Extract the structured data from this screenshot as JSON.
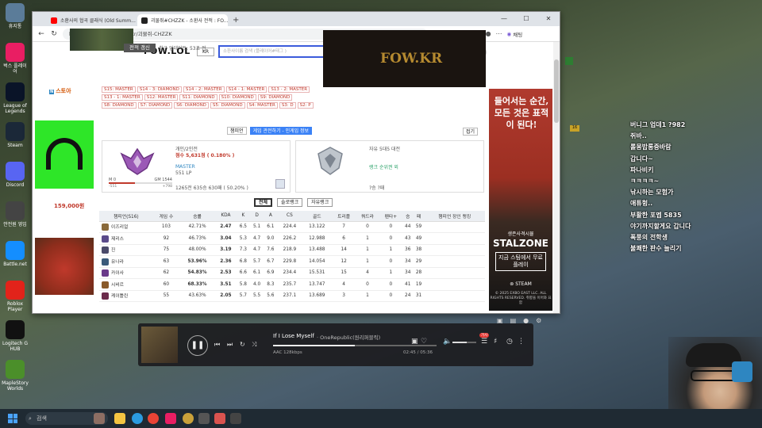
{
  "desktop": {
    "icons": [
      {
        "label": "휴지통",
        "color": "#5b7c99"
      },
      {
        "label": "벅스 플레이어",
        "color": "#e91e63"
      },
      {
        "label": "League of Legends",
        "color": "#0a1428"
      },
      {
        "label": "Steam",
        "color": "#1b2838"
      },
      {
        "label": "Discord",
        "color": "#5865f2"
      },
      {
        "label": "안전원 영입",
        "color": "#444"
      },
      {
        "label": "Battle.net",
        "color": "#148eff"
      },
      {
        "label": "Roblox Player",
        "color": "#e2231a"
      },
      {
        "label": "Logitech G HUB",
        "color": "#111"
      },
      {
        "label": "MapleStory Worlds",
        "color": "#4b8f2a"
      }
    ]
  },
  "browser": {
    "tabs": [
      {
        "title": "소환사의 협곡 클래식 (Old Summ...",
        "favicon_color": "#ff0000",
        "active": false
      },
      {
        "title": "괴물쥐#CHZZK - 소환사 전적 : FO...",
        "favicon_color": "#222222",
        "active": true
      }
    ],
    "url": "https://www.fow.lol/find/kr/괴물쥐-CHZZK",
    "chat_label": "채팅"
  },
  "site": {
    "logo": "FOW.LOL",
    "region": "KR",
    "search_placeholder": "소환사이름 검색 (플레이어#태그 )",
    "renew_label": "전적 갱신",
    "updated_text": "최근 업데이트: 53초 전",
    "fow_banner": "FOW.KR",
    "seasons": [
      "S15: MASTER",
      "S14 - 3: DIAMOND",
      "S14 - 2: MASTER",
      "S14 - 1: MASTER",
      "S13 - 2: MASTER",
      "S13 - 1: MASTER",
      "S12: MASTER",
      "S11: DIAMOND",
      "S10: DIAMOND",
      "S9: DIAMOND",
      "S8: DIAMOND",
      "S7: DIAMOND",
      "S6: DIAMOND",
      "S5: DIAMOND",
      "S4: MASTER",
      "S3: D",
      "S2: P"
    ],
    "view_tabs": [
      "챔피언",
      "게임 관전하기 - 인게임 정보"
    ],
    "close_label": "접기"
  },
  "ads": {
    "stoa_label": "스토아",
    "headset_price": "159,000원",
    "right": {
      "headline": "들어서는 순간, 모든 것은 표적이 된다!",
      "kicker": "생존사격시뮬",
      "game": "STALZONE",
      "cta": "지금 스팀에서 무료 플레이",
      "platform": "STEAM",
      "copyright": "© 2025 EXBO EAST LLC. ALL RIGHTS RESERVED. 취향을 이어와 요함"
    }
  },
  "rank": {
    "mode": "개인/2인전",
    "points": "점수 5,631점 ( 0.180% )",
    "tier": "MASTER",
    "lp": "551 LP",
    "gauge_left": "M 0",
    "gauge_right": "GM 1544",
    "gauge_lo": "-551",
    "gauge_hi": "+798",
    "gauge_progress": 0.41,
    "winloss": "1265전 635승 630패 ( 50.20% )"
  },
  "flex": {
    "mode": "자유 5대5 대전",
    "unranked": "랭크 순위권 외",
    "winloss": "?승 ?패"
  },
  "filters": [
    "전체",
    "솔로랭크",
    "자유랭크"
  ],
  "table": {
    "headers": [
      "챔피언(S16)",
      "게임 수",
      "승률",
      "KDA",
      "K",
      "D",
      "A",
      "CS",
      "골드",
      "트리플",
      "쿼드라",
      "펜타+",
      "승",
      "패",
      "챔피언 장인 랭킹"
    ],
    "rows": [
      {
        "champ": "이즈리얼",
        "games": "103",
        "wr": "42.71%",
        "wrc": "lo",
        "kda": "2.47",
        "k": "6.5",
        "d": "5.1",
        "a": "6.1",
        "cs": "224.4",
        "gold": "13.122",
        "triple": "7",
        "quadra": "0",
        "penta": "0",
        "win": "44",
        "loss": "59",
        "color": "#8a6a3a"
      },
      {
        "champ": "제리스",
        "games": "92",
        "wr": "46.73%",
        "wrc": "lo",
        "kda": "3.04",
        "k": "5.3",
        "d": "4.7",
        "a": "9.0",
        "cs": "226.2",
        "gold": "12.988",
        "triple": "6",
        "quadra": "1",
        "penta": "0",
        "win": "43",
        "loss": "49",
        "color": "#5a4a8a"
      },
      {
        "champ": "진",
        "games": "75",
        "wr": "48.00%",
        "wrc": "lo",
        "kda": "3.19",
        "k": "7.3",
        "d": "4.7",
        "a": "7.6",
        "cs": "218.9",
        "gold": "13.488",
        "triple": "14",
        "quadra": "1",
        "penta": "1",
        "win": "36",
        "loss": "38",
        "color": "#4a4a6a"
      },
      {
        "champ": "유나라",
        "games": "63",
        "wr": "53.96%",
        "wrc": "mid",
        "kda": "2.36",
        "k": "6.8",
        "d": "5.7",
        "a": "6.7",
        "cs": "229.8",
        "gold": "14.054",
        "triple": "12",
        "quadra": "1",
        "penta": "0",
        "win": "34",
        "loss": "29",
        "color": "#3a5a7a"
      },
      {
        "champ": "카이사",
        "games": "62",
        "wr": "54.83%",
        "wrc": "mid",
        "kda": "2.53",
        "k": "6.6",
        "d": "6.1",
        "a": "6.9",
        "cs": "234.4",
        "gold": "15.531",
        "triple": "15",
        "quadra": "4",
        "penta": "1",
        "win": "34",
        "loss": "28",
        "color": "#6a3a8a"
      },
      {
        "champ": "시비르",
        "games": "60",
        "wr": "68.33%",
        "wrc": "hi",
        "kda": "3.51",
        "k": "5.8",
        "d": "4.0",
        "a": "8.3",
        "cs": "235.7",
        "gold": "13.747",
        "triple": "4",
        "quadra": "0",
        "penta": "0",
        "win": "41",
        "loss": "19",
        "color": "#8a5a2a"
      },
      {
        "champ": "케이틀린",
        "games": "55",
        "wr": "43.63%",
        "wrc": "lo",
        "kda": "2.05",
        "k": "5.7",
        "d": "5.5",
        "a": "5.6",
        "cs": "237.1",
        "gold": "13.689",
        "triple": "3",
        "quadra": "1",
        "penta": "0",
        "win": "24",
        "loss": "31",
        "color": "#6a2a4a"
      }
    ]
  },
  "chat": [
    {
      "text": "버니그 업데1 ?982",
      "top": 0.0
    },
    {
      "text": "쥐바..",
      "top": 0.0
    },
    {
      "text": "롤몽밥롱증바람",
      "top": 0.0
    },
    {
      "text": "갑니다~",
      "top": 0.0
    },
    {
      "text": "파나비키",
      "top": 0.0
    },
    {
      "text": "ㅋㅋㅋㅋ~",
      "top": 0.0
    },
    {
      "text": "낚시하는 모험가",
      "top": 0.0
    },
    {
      "text": "애튜헝..",
      "top": 0.0
    },
    {
      "text": "부활한 포멥 5835",
      "top": 0.0
    },
    {
      "text": "야기까지할게요 갑니다",
      "top": 0.0
    },
    {
      "text": "폭풍의 전학생",
      "top": 0.0
    },
    {
      "text": "불쾌한 판수 늘리기",
      "top": 0.0
    }
  ],
  "chat_badge": "16",
  "player": {
    "song": "If I Lose Myself",
    "artist": "· OneRepublic(원리퍼블릭)",
    "quality": "AAC 128kbps",
    "time": "02:45 / 05:36",
    "progress": 0.5,
    "volume": 0.6,
    "lyric_badge": "가사"
  },
  "taskbar": {
    "search_label": "검색"
  }
}
